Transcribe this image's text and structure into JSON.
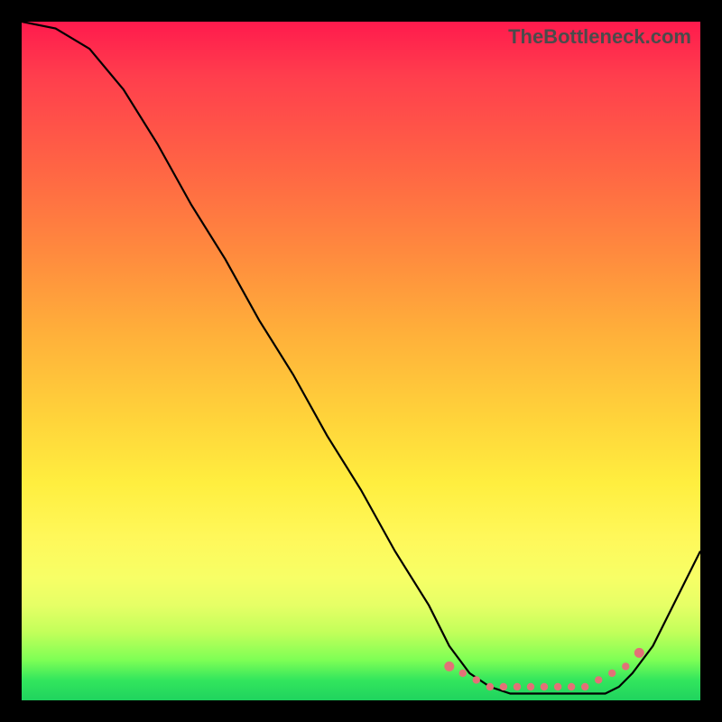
{
  "watermark": "TheBottleneck.com",
  "colors": {
    "curve": "#000000",
    "dots": "#e37177",
    "background": "#000000"
  },
  "chart_data": {
    "type": "line",
    "title": "",
    "xlabel": "",
    "ylabel": "",
    "xlim": [
      0,
      100
    ],
    "ylim": [
      0,
      100
    ],
    "x": [
      0,
      5,
      10,
      15,
      20,
      25,
      30,
      35,
      40,
      45,
      50,
      55,
      60,
      63,
      66,
      69,
      72,
      75,
      78,
      80,
      82,
      84,
      86,
      88,
      90,
      93,
      96,
      100
    ],
    "values": [
      100,
      99,
      96,
      90,
      82,
      73,
      65,
      56,
      48,
      39,
      31,
      22,
      14,
      8,
      4,
      2,
      1,
      1,
      1,
      1,
      1,
      1,
      1,
      2,
      4,
      8,
      14,
      22
    ],
    "series": [
      {
        "name": "bottleneck-curve",
        "x": [
          0,
          5,
          10,
          15,
          20,
          25,
          30,
          35,
          40,
          45,
          50,
          55,
          60,
          63,
          66,
          69,
          72,
          75,
          78,
          80,
          82,
          84,
          86,
          88,
          90,
          93,
          96,
          100
        ],
        "y": [
          100,
          99,
          96,
          90,
          82,
          73,
          65,
          56,
          48,
          39,
          31,
          22,
          14,
          8,
          4,
          2,
          1,
          1,
          1,
          1,
          1,
          1,
          1,
          2,
          4,
          8,
          14,
          22
        ]
      },
      {
        "name": "optimal-range-dots",
        "x": [
          63,
          65,
          67,
          69,
          71,
          73,
          75,
          77,
          79,
          81,
          83,
          85,
          87,
          89,
          91
        ],
        "y": [
          5,
          4,
          3,
          2,
          2,
          2,
          2,
          2,
          2,
          2,
          2,
          3,
          4,
          5,
          7
        ]
      }
    ]
  }
}
